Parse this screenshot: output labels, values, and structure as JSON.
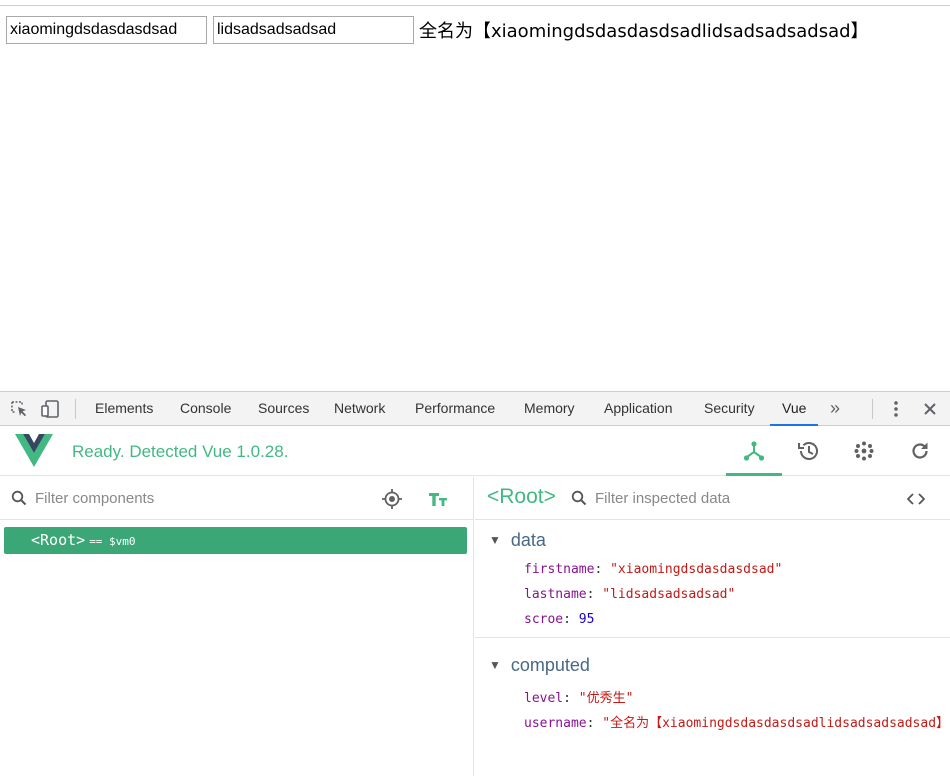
{
  "page": {
    "firstname_value": "xiaomingdsdasdasdsad",
    "lastname_value": "lidsadsadsadsad",
    "fullname_text": "全名为【xiaomingdsdasdasdsadlidsadsadsadsad】"
  },
  "devtools": {
    "tabs": [
      {
        "label": "Elements"
      },
      {
        "label": "Console"
      },
      {
        "label": "Sources"
      },
      {
        "label": "Network"
      },
      {
        "label": "Performance"
      },
      {
        "label": "Memory"
      },
      {
        "label": "Application"
      },
      {
        "label": "Security"
      },
      {
        "label": "Vue",
        "active": true
      }
    ],
    "overflow_symbol": "»",
    "icons": [
      "inspect-element-icon",
      "device-toolbar-icon",
      "more-tabs-icon",
      "kebab-menu-icon",
      "close-icon"
    ]
  },
  "vue_panel": {
    "status": "Ready. Detected Vue 1.0.28.",
    "accent_color": "#42b983",
    "nav_icons": [
      "components-tree-icon",
      "history-icon",
      "vuex-icon",
      "refresh-icon"
    ],
    "components": {
      "filter_placeholder": "Filter components",
      "selected_component": "<Root>",
      "vm_ref": "== $vm0"
    },
    "inspector": {
      "title": "<Root>",
      "filter_placeholder": "Filter inspected data",
      "data_section": {
        "label": "data",
        "props": [
          {
            "key": "firstname",
            "value": "\"xiaomingdsdasdasdsad\"",
            "kind": "string"
          },
          {
            "key": "lastname",
            "value": "\"lidsadsadsadsad\"",
            "kind": "string"
          },
          {
            "key": "scroe",
            "value": "95",
            "kind": "number"
          }
        ]
      },
      "computed_section": {
        "label": "computed",
        "props": [
          {
            "key": "level",
            "value": "\"优秀生\"",
            "kind": "string"
          },
          {
            "key": "username",
            "value": "\"全名为【xiaomingdsdasdasdsadlidsadsadsadsad】\"",
            "kind": "string"
          }
        ]
      }
    }
  }
}
